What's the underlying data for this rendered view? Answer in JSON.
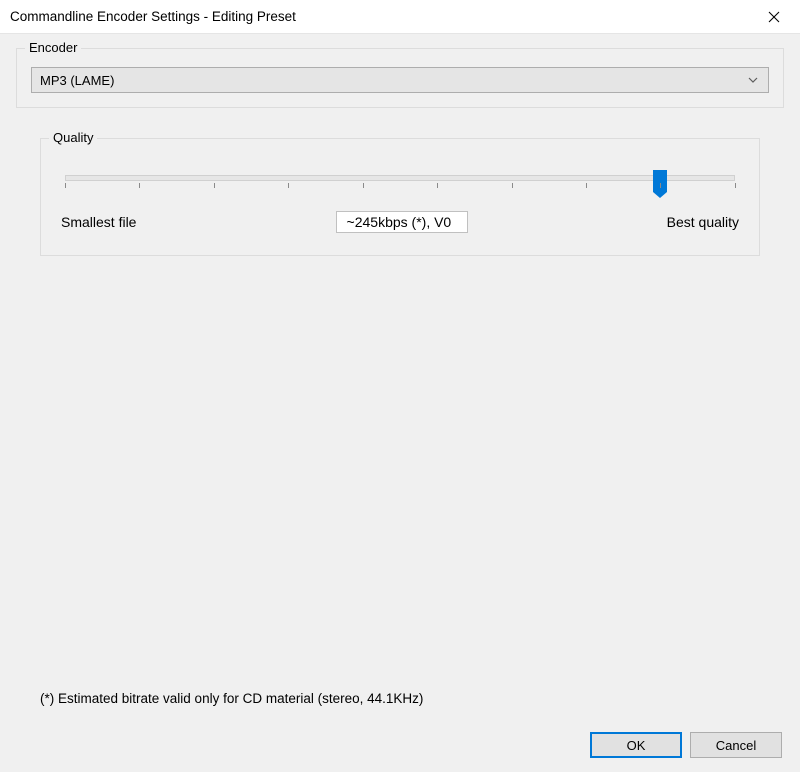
{
  "window": {
    "title": "Commandline Encoder Settings - Editing Preset"
  },
  "encoder": {
    "legend": "Encoder",
    "selected": "MP3 (LAME)"
  },
  "quality": {
    "legend": "Quality",
    "left_label": "Smallest file",
    "right_label": "Best quality",
    "current_value_display": "~245kbps (*), V0",
    "slider_value": 8,
    "slider_min": 0,
    "slider_max": 9
  },
  "footnote": "(*) Estimated bitrate valid only for CD material (stereo, 44.1KHz)",
  "buttons": {
    "ok": "OK",
    "cancel": "Cancel"
  }
}
